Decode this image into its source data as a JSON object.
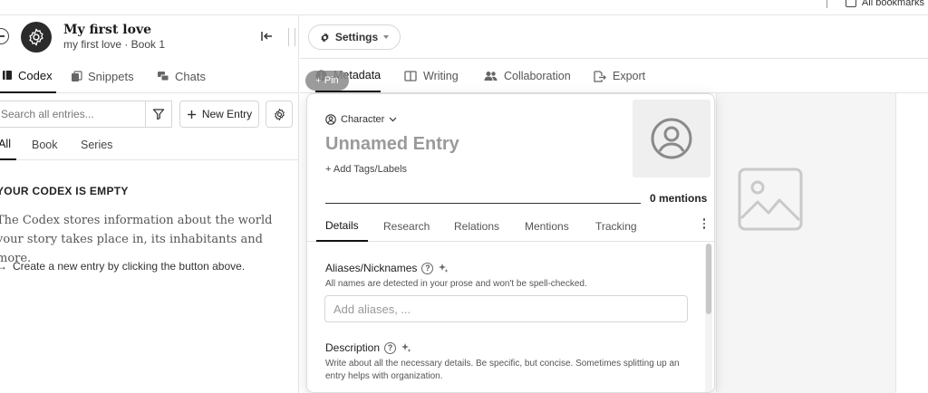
{
  "browser": {
    "bookmarks_label": "All bookmarks"
  },
  "project": {
    "title": "My first love",
    "subtitle": "my first love · Book 1"
  },
  "left_tabs": [
    {
      "label": "Codex",
      "active": true,
      "icon": "book-icon"
    },
    {
      "label": "Snippets",
      "active": false,
      "icon": "snippets-icon"
    },
    {
      "label": "Chats",
      "active": false,
      "icon": "chat-icon"
    }
  ],
  "search": {
    "placeholder": "Search all entries..."
  },
  "new_entry_label": "New Entry",
  "filter_tabs": [
    {
      "label": "All",
      "active": true
    },
    {
      "label": "Book",
      "active": false
    },
    {
      "label": "Series",
      "active": false
    }
  ],
  "empty_state": {
    "title": "YOUR CODEX IS EMPTY",
    "body": "The Codex stores information about the world your story takes place in, its inhabitants and more.",
    "cta": "Create a new entry by clicking the button above."
  },
  "settings_label": "Settings",
  "pin_label": "Pin",
  "right_tabs": [
    {
      "label": "Metadata",
      "active": true,
      "icon": "info-icon"
    },
    {
      "label": "Writing",
      "active": false,
      "icon": "writing-icon"
    },
    {
      "label": "Collaboration",
      "active": false,
      "icon": "people-icon"
    },
    {
      "label": "Export",
      "active": false,
      "icon": "export-icon"
    }
  ],
  "entry": {
    "type": "Character",
    "name": "Unnamed Entry",
    "add_tags": "+ Add Tags/Labels",
    "mentions": "0 mentions",
    "tabs": [
      {
        "label": "Details",
        "active": true
      },
      {
        "label": "Research",
        "active": false
      },
      {
        "label": "Relations",
        "active": false
      },
      {
        "label": "Mentions",
        "active": false
      },
      {
        "label": "Tracking",
        "active": false
      }
    ],
    "aliases": {
      "label": "Aliases/Nicknames",
      "help": "All names are detected in your prose and won't be spell-checked.",
      "placeholder": "Add aliases, ..."
    },
    "description": {
      "label": "Description",
      "help": "Write about all the necessary details. Be specific, but concise. Sometimes splitting up an entry helps with organization."
    }
  },
  "colors": {
    "accent": "#111111",
    "muted": "#9a9a9a",
    "border": "#d6d6d6"
  }
}
